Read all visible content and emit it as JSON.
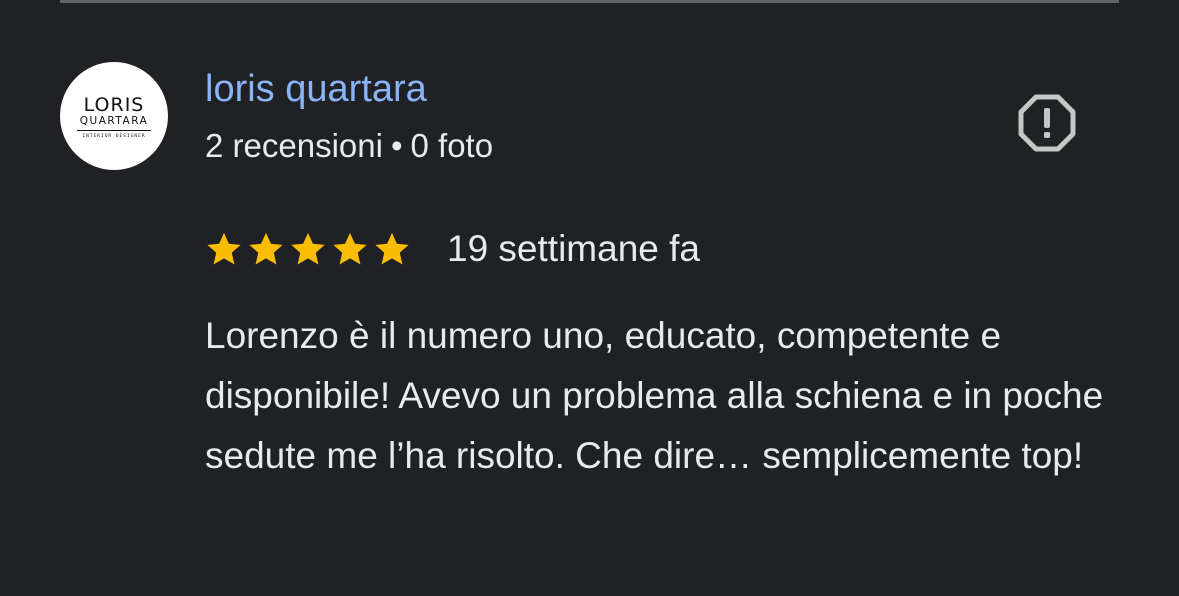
{
  "reviewer": {
    "name": "loris quartara",
    "reviews_count": "2 recensioni",
    "separator": "•",
    "photos_count": "0 foto",
    "avatar": {
      "logo_line1": "LORIS",
      "logo_line2": "QUARTARA",
      "logo_line3": "INTERIOR DESIGNER"
    }
  },
  "report_icon": "report-octagon-icon",
  "review": {
    "rating": 5,
    "max_rating": 5,
    "date": "19 settimane fa",
    "text": "Lorenzo è il numero uno, educato, competente e disponibile! Avevo un problema alla schiena e in poche sedute me l’ha risolto. Che dire… semplicemente top!"
  },
  "colors": {
    "background": "#202124",
    "name": "#8ab4f8",
    "text": "#e8eaed",
    "star": "#fbbc04",
    "icon": "#c4c7c5"
  }
}
